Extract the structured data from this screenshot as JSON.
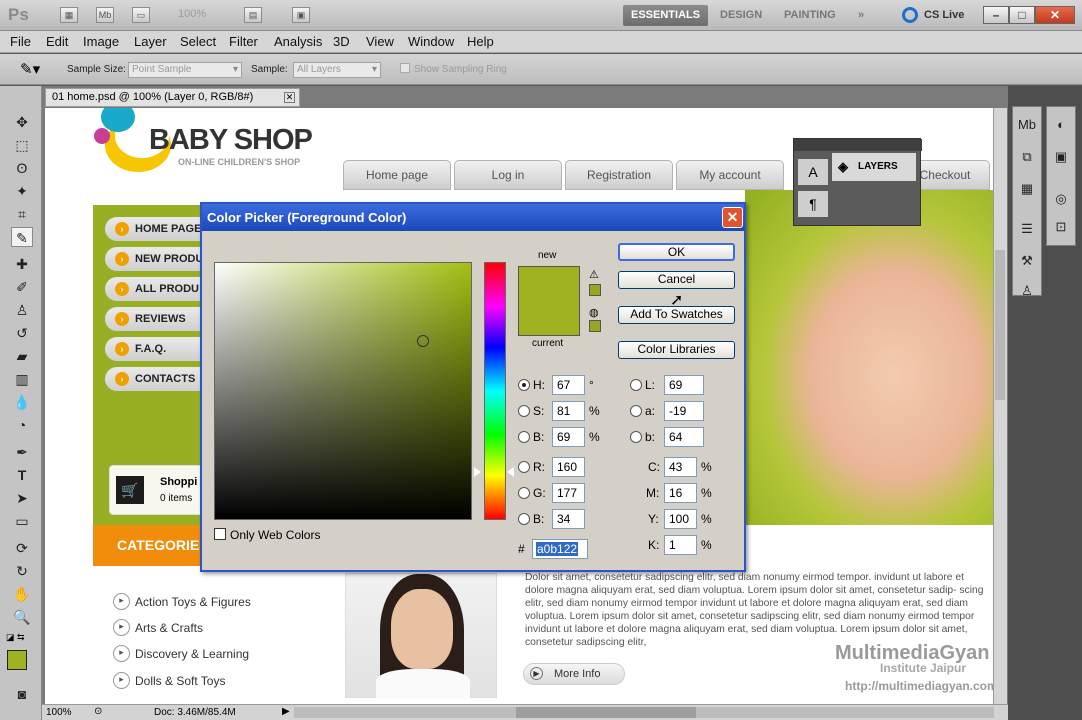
{
  "app": {
    "logo": "Ps",
    "zoom": "100%",
    "workspaces": [
      "ESSENTIALS",
      "DESIGN",
      "PAINTING"
    ],
    "workspace_more": "»",
    "cslive": "CS Live",
    "window_controls": [
      "–",
      "□",
      "✕"
    ]
  },
  "menu": [
    "File",
    "Edit",
    "Image",
    "Layer",
    "Select",
    "Filter",
    "Analysis",
    "3D",
    "View",
    "Window",
    "Help"
  ],
  "options": {
    "sample_size_label": "Sample Size:",
    "sample_size_value": "Point Sample",
    "sample_label": "Sample:",
    "sample_value": "All Layers",
    "sampling_ring_label": "Show Sampling Ring"
  },
  "document": {
    "tab_title": "01 home.psd @ 100% (Layer 0, RGB/8#)"
  },
  "website": {
    "brand": "BABY SHOP",
    "brand_sub": "ON-LINE CHILDREN'S SHOP",
    "nav_tabs": [
      "Home page",
      "Log in",
      "Registration",
      "My account",
      "Checkout"
    ],
    "side_nav": [
      "HOME PAGE",
      "NEW PRODU",
      "ALL PRODU",
      "REVIEWS",
      "F.A.Q.",
      "CONTACTS"
    ],
    "cart_title": "Shoppi",
    "cart_items": "0 items",
    "categories_title": "CATEGORIES",
    "categories": [
      "Action Toys & Figures",
      "Arts & Crafts",
      "Discovery & Learning",
      "Dolls & Soft Toys"
    ],
    "lorem": "Dolor sit amet, consetetur sadipscing elitr, sed diam nonumy eirmod tempor. invidunt ut labore et dolore magna aliquyam erat, sed diam voluptua. Lorem ipsum dolor sit amet, consetetur sadip- scing elitr, sed diam nonumy eirmod tempor invidunt ut labore et dolore magna aliquyam erat, sed diam voluptua. Lorem ipsum dolor sit amet, consetetur sadipscing elitr, sed diam nonumy eirmod tempor invidunt ut labore et dolore magna aliquyam erat, sed diam voluptua. Lorem ipsum dolor sit amet, consetetur sadipscing elitr,",
    "more_info": "More Info"
  },
  "watermark": {
    "line1": "MultimediaGyan",
    "line2": "Institute Jaipur",
    "line3": "http://multimediagyan.com"
  },
  "layers_panel": {
    "label": "LAYERS"
  },
  "color_picker": {
    "title": "Color Picker (Foreground Color)",
    "close": "✕",
    "new_label": "new",
    "current_label": "current",
    "new_color": "#a0b122",
    "buttons": {
      "ok": "OK",
      "cancel": "Cancel",
      "swatches": "Add To Swatches",
      "libraries": "Color Libraries"
    },
    "hsb": {
      "h_label": "H:",
      "h": "67",
      "h_unit": "°",
      "s_label": "S:",
      "s": "81",
      "s_unit": "%",
      "b_label": "B:",
      "b": "69",
      "b_unit": "%"
    },
    "rgb": {
      "r_label": "R:",
      "r": "160",
      "g_label": "G:",
      "g": "177",
      "b_label": "B:",
      "b": "34"
    },
    "lab": {
      "l_label": "L:",
      "l": "69",
      "a_label": "a:",
      "a": "-19",
      "b_label": "b:",
      "b": "64"
    },
    "cmyk": {
      "c_label": "C:",
      "c": "43",
      "m_label": "M:",
      "m": "16",
      "y_label": "Y:",
      "y": "100",
      "k_label": "K:",
      "k": "1",
      "unit": "%"
    },
    "hex_label": "#",
    "hex": "a0b122",
    "web_colors_label": "Only Web Colors"
  },
  "status": {
    "zoom": "100%",
    "doc": "Doc: 3.46M/85.4M"
  }
}
